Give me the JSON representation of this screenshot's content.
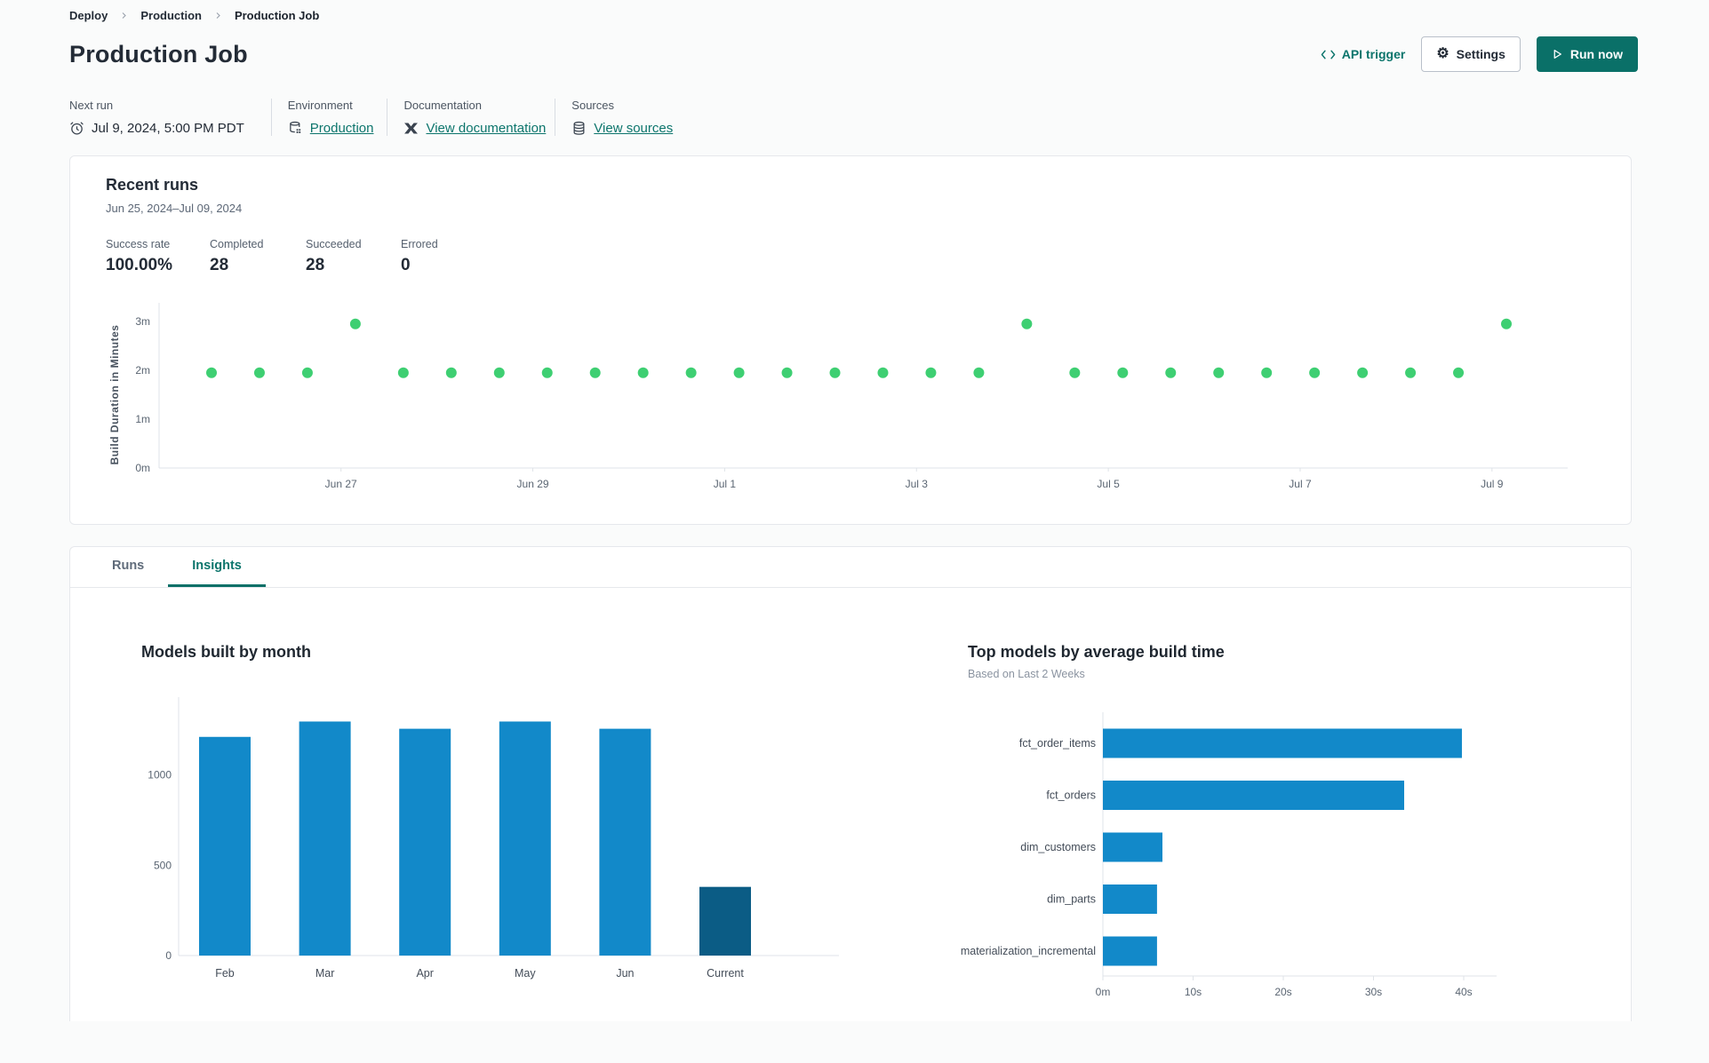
{
  "colors": {
    "accent_teal": "#0a7068",
    "link_teal": "#0c756c",
    "bar_blue": "#1289c9",
    "bar_navy": "#0b5c85",
    "dot_green": "#3ecf72",
    "axis_line": "#dfe3e8"
  },
  "breadcrumb": {
    "items": [
      "Deploy",
      "Production",
      "Production Job"
    ]
  },
  "header": {
    "title": "Production Job",
    "api_trigger_label": "API trigger",
    "settings_label": "Settings",
    "run_now_label": "Run now"
  },
  "meta": {
    "next_run": {
      "label": "Next run",
      "value": "Jul 9, 2024, 5:00 PM PDT"
    },
    "environment": {
      "label": "Environment",
      "value": "Production"
    },
    "documentation": {
      "label": "Documentation",
      "value": "View documentation"
    },
    "sources": {
      "label": "Sources",
      "value": "View sources"
    }
  },
  "recent_runs": {
    "title": "Recent runs",
    "date_range": "Jun 25, 2024–Jul 09, 2024",
    "stats": [
      {
        "label": "Success rate",
        "value": "100.00%"
      },
      {
        "label": "Completed",
        "value": "28"
      },
      {
        "label": "Succeeded",
        "value": "28"
      },
      {
        "label": "Errored",
        "value": "0"
      }
    ]
  },
  "tabs": [
    {
      "label": "Runs",
      "active": false
    },
    {
      "label": "Insights",
      "active": true
    }
  ],
  "chart_data": [
    {
      "id": "build-duration-scatter",
      "type": "scatter",
      "ylabel": "Build Duration in Minutes",
      "ylim": [
        0,
        3.1
      ],
      "yticks": [
        {
          "v": 0,
          "label": "0m"
        },
        {
          "v": 1,
          "label": "1m"
        },
        {
          "v": 2,
          "label": "2m"
        },
        {
          "v": 3,
          "label": "3m"
        }
      ],
      "xticks": [
        {
          "i": 2.7,
          "label": "Jun 27"
        },
        {
          "i": 6.7,
          "label": "Jun 29"
        },
        {
          "i": 10.7,
          "label": "Jul 1"
        },
        {
          "i": 14.7,
          "label": "Jul 3"
        },
        {
          "i": 18.7,
          "label": "Jul 5"
        },
        {
          "i": 22.7,
          "label": "Jul 7"
        },
        {
          "i": 26.7,
          "label": "Jul 9"
        }
      ],
      "points_minutes": [
        1.95,
        1.95,
        1.95,
        2.95,
        1.95,
        1.95,
        1.95,
        1.95,
        1.95,
        1.95,
        1.95,
        1.95,
        1.95,
        1.95,
        1.95,
        1.95,
        1.95,
        2.95,
        1.95,
        1.95,
        1.95,
        1.95,
        1.95,
        1.95,
        1.95,
        1.95,
        1.95,
        2.95
      ],
      "point_color": "#3ecf72",
      "grid": false
    },
    {
      "id": "models-built-by-month",
      "type": "bar",
      "title": "Models built by month",
      "categories": [
        "Feb",
        "Mar",
        "Apr",
        "May",
        "Jun",
        "Current"
      ],
      "values": [
        1210,
        1295,
        1255,
        1295,
        1255,
        380
      ],
      "bar_colors": [
        "#1289c9",
        "#1289c9",
        "#1289c9",
        "#1289c9",
        "#1289c9",
        "#0b5c85"
      ],
      "yticks": [
        0,
        500,
        1000
      ],
      "ylim": [
        0,
        1430
      ],
      "grid": false
    },
    {
      "id": "top-models-by-average-build-time",
      "type": "hbar",
      "title": "Top models by average build time",
      "subtitle": "Based on Last 2 Weeks",
      "categories": [
        "fct_order_items",
        "fct_orders",
        "dim_customers",
        "dim_parts",
        "materialization_incremental"
      ],
      "values_seconds": [
        39.8,
        33.4,
        6.6,
        6.0,
        6.0
      ],
      "xticks": [
        {
          "v": 0,
          "label": "0m"
        },
        {
          "v": 10,
          "label": "10s"
        },
        {
          "v": 20,
          "label": "20s"
        },
        {
          "v": 30,
          "label": "30s"
        },
        {
          "v": 40,
          "label": "40s"
        }
      ],
      "xlim": [
        0,
        44
      ],
      "bar_color": "#1289c9",
      "grid": false
    }
  ]
}
